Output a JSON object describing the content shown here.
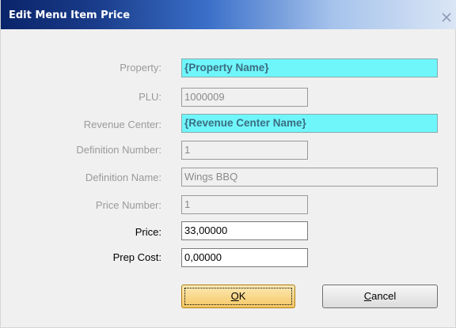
{
  "window": {
    "title": "Edit Menu Item Price"
  },
  "form": {
    "property": {
      "label": "Property:",
      "value": "{Property Name}"
    },
    "plu": {
      "label": "PLU:",
      "value": "1000009"
    },
    "revenue_center": {
      "label": "Revenue Center:",
      "value": "{Revenue Center Name}"
    },
    "definition_number": {
      "label": "Definition Number:",
      "value": "1"
    },
    "definition_name": {
      "label": "Definition Name:",
      "value": "Wings BBQ"
    },
    "price_number": {
      "label": "Price Number:",
      "value": "1"
    },
    "price": {
      "label": "Price:",
      "value": "33,00000"
    },
    "prep_cost": {
      "label": "Prep Cost:",
      "value": "0,00000"
    }
  },
  "buttons": {
    "ok_mnemonic": "O",
    "ok_rest": "K",
    "cancel_mnemonic": "C",
    "cancel_rest": "ancel"
  },
  "colors": {
    "highlight_field": "#6ff6fb",
    "default_button": "#f6c865",
    "title_gradient_start": "#0a246a"
  },
  "icons": {
    "close": "close-x-icon"
  }
}
